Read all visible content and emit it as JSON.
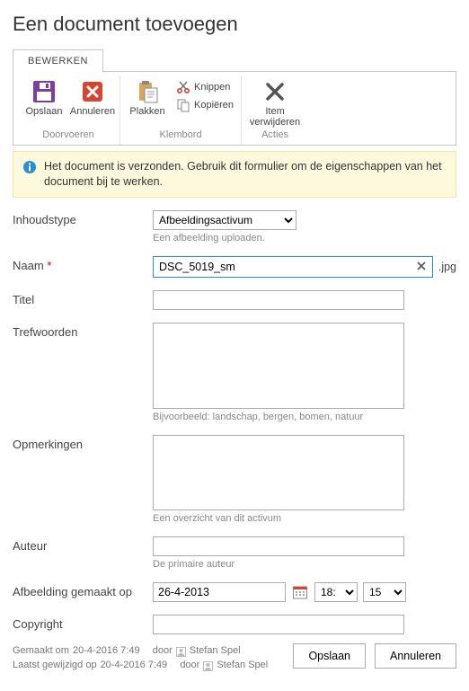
{
  "title": "Een document toevoegen",
  "tab_label": "BEWERKEN",
  "ribbon": {
    "groups": {
      "doorvoeren": {
        "label": "Doorvoeren",
        "save": "Opslaan",
        "cancel": "Annuleren"
      },
      "klembord": {
        "label": "Klembord",
        "paste": "Plakken",
        "cut": "Knippen",
        "copy": "Kopiëren"
      },
      "acties": {
        "label": "Acties",
        "delete_line1": "Item",
        "delete_line2": "verwijderen"
      }
    }
  },
  "banner": "Het document is verzonden. Gebruik dit formulier om de eigenschappen van het document bij te werken.",
  "form": {
    "inhoudstype": {
      "label": "Inhoudstype",
      "value": "Afbeeldingsactivum",
      "help": "Een afbeelding uploaden."
    },
    "naam": {
      "label": "Naam",
      "required": "*",
      "value": "DSC_5019_sm",
      "ext": ".jpg"
    },
    "titel": {
      "label": "Titel",
      "value": ""
    },
    "trefwoorden": {
      "label": "Trefwoorden",
      "value": "",
      "help": "Bijvoorbeeld: landschap, bergen, bomen, natuur"
    },
    "opmerkingen": {
      "label": "Opmerkingen",
      "value": "",
      "help": "Een overzicht van dit activum"
    },
    "auteur": {
      "label": "Auteur",
      "value": "",
      "help": "De primaire auteur"
    },
    "afbeelding_gemaakt_op": {
      "label": "Afbeelding gemaakt op",
      "date": "26-4-2013",
      "hour": "18:",
      "minute": "15"
    },
    "copyright": {
      "label": "Copyright",
      "value": ""
    }
  },
  "meta": {
    "created_prefix": "Gemaakt om ",
    "created_datetime": "20-4-2016 7:49",
    "modified_prefix": "Laatst gewijzigd op ",
    "modified_datetime": "20-4-2016 7:49",
    "by_label": "door",
    "user": "Stefan Spel"
  },
  "buttons": {
    "save": "Opslaan",
    "cancel": "Annuleren"
  }
}
